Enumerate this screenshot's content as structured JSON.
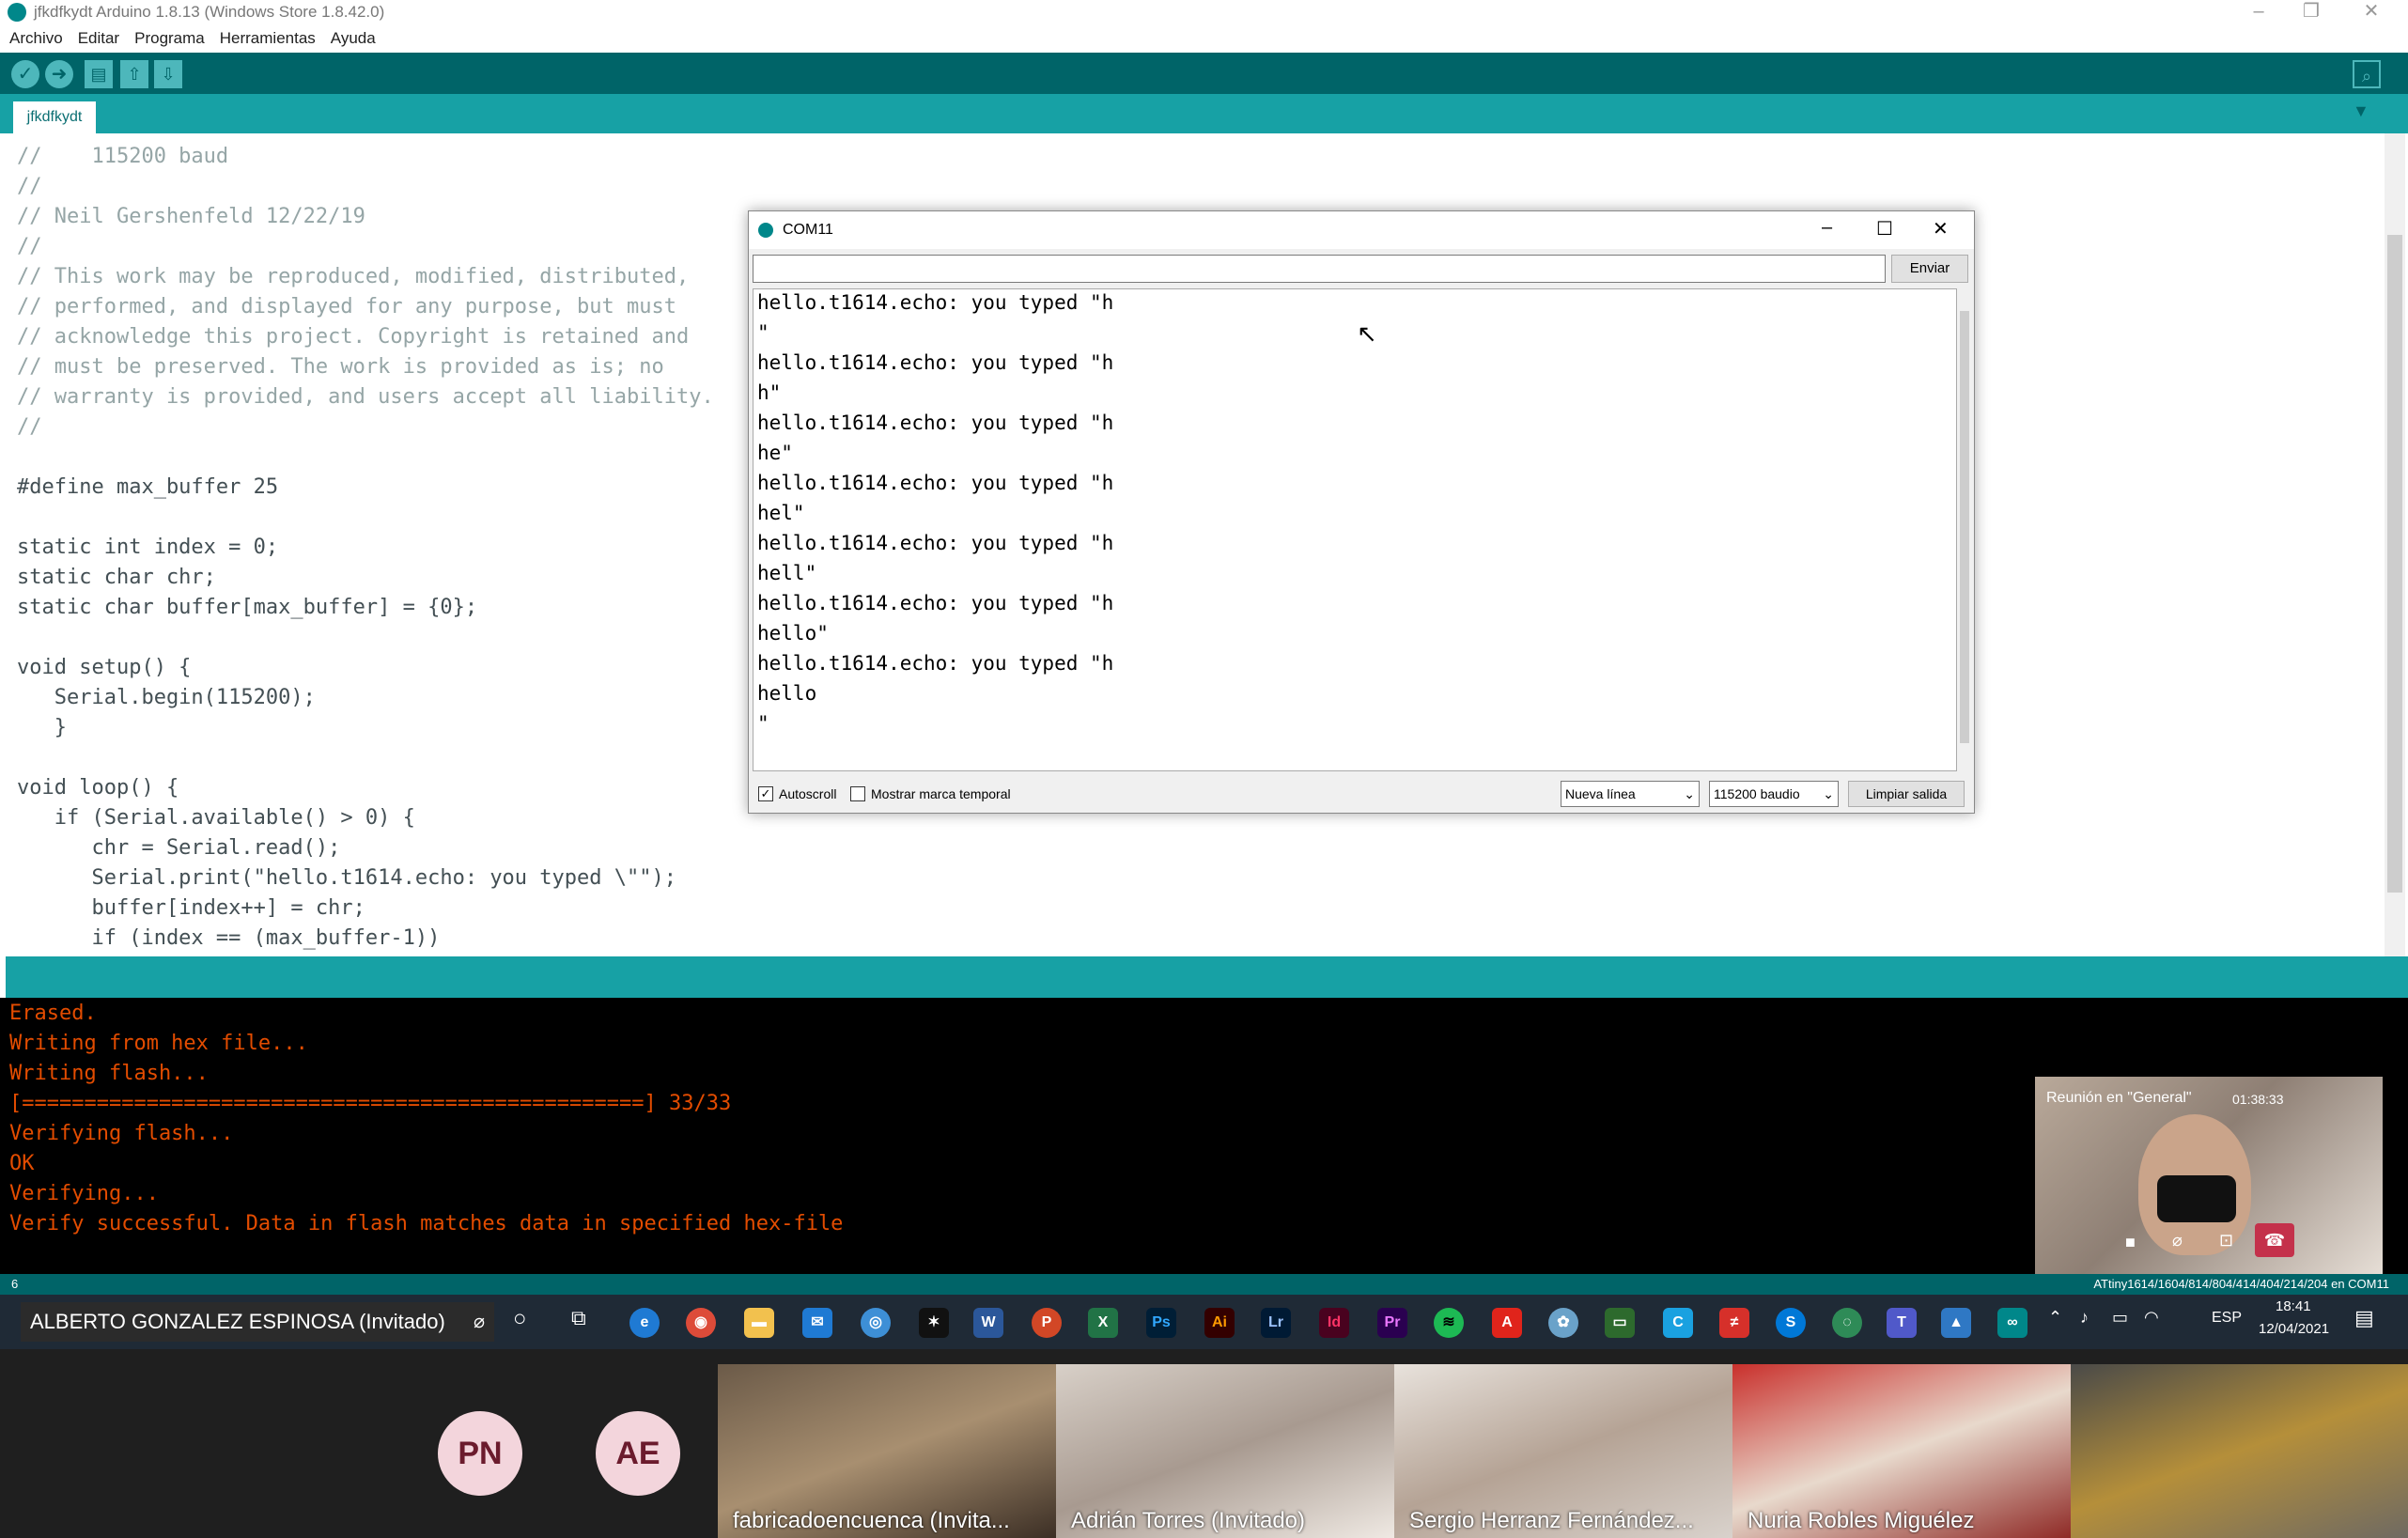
{
  "window": {
    "title": "jfkdfkydt Arduino 1.8.13 (Windows Store 1.8.42.0)"
  },
  "menu": [
    "Archivo",
    "Editar",
    "Programa",
    "Herramientas",
    "Ayuda"
  ],
  "toolbar": {
    "verify_icon": "check-icon",
    "upload_icon": "arrow-right-icon",
    "new_icon": "new-file-icon",
    "open_icon": "arrow-up-icon",
    "save_icon": "arrow-down-icon",
    "monitor_icon": "magnifier-icon"
  },
  "tab": {
    "label": "jfkdfkydt"
  },
  "code_lines": [
    "//    115200 baud",
    "//",
    "// Neil Gershenfeld 12/22/19",
    "//",
    "// This work may be reproduced, modified, distributed,",
    "// performed, and displayed for any purpose, but must",
    "// acknowledge this project. Copyright is retained and",
    "// must be preserved. The work is provided as is; no",
    "// warranty is provided, and users accept all liability.",
    "//",
    "",
    "#define max_buffer 25",
    "",
    "static int index = 0;",
    "static char chr;",
    "static char buffer[max_buffer] = {0};",
    "",
    "void setup() {",
    "   Serial.begin(115200);",
    "   }",
    "",
    "void loop() {",
    "   if (Serial.available() > 0) {",
    "      chr = Serial.read();",
    "      Serial.print(\"hello.t1614.echo: you typed \\\"\");",
    "      buffer[index++] = chr;",
    "      if (index == (max_buffer-1))"
  ],
  "console_lines": [
    "Erased.",
    "Writing from hex file...",
    "Writing flash...",
    "[==================================================] 33/33",
    "Verifying flash...",
    "OK",
    "Verifying...",
    "Verify successful. Data in flash matches data in specified hex-file"
  ],
  "status_line_number": "6",
  "board_info": "ATtiny1614/1604/814/804/414/404/214/204 en COM11",
  "serial": {
    "title": "COM11",
    "send_label": "Enviar",
    "output": [
      "hello.t1614.echo: you typed \"h",
      "\"",
      "hello.t1614.echo: you typed \"h",
      "h\"",
      "hello.t1614.echo: you typed \"h",
      "he\"",
      "hello.t1614.echo: you typed \"h",
      "hel\"",
      "hello.t1614.echo: you typed \"h",
      "hell\"",
      "hello.t1614.echo: you typed \"h",
      "hello\"",
      "hello.t1614.echo: you typed \"h",
      "hello",
      "\""
    ],
    "autoscroll_label": "Autoscroll",
    "autoscroll_checked": true,
    "timestamp_label": "Mostrar marca temporal",
    "timestamp_checked": false,
    "line_ending": "Nueva línea",
    "baud": "115200 baudio",
    "clear_label": "Limpiar salida"
  },
  "taskbar": {
    "presenter": "ALBERTO GONZALEZ ESPINOSA (Invitado)",
    "apps": [
      "Ps",
      "Ai",
      "Lr",
      "Id",
      "Pr"
    ],
    "lang": "ESP",
    "time": "18:41",
    "date": "12/04/2021"
  },
  "meeting": {
    "title": "Reunión en \"General\"",
    "elapsed": "01:38:33",
    "avatars": [
      "PN",
      "AE"
    ],
    "participants": [
      "fabricadoencuenca (Invita...",
      "Adrián Torres (Invitado)",
      "Sergio Herranz Fernández...",
      "Nuria Robles Miguélez",
      ""
    ]
  }
}
